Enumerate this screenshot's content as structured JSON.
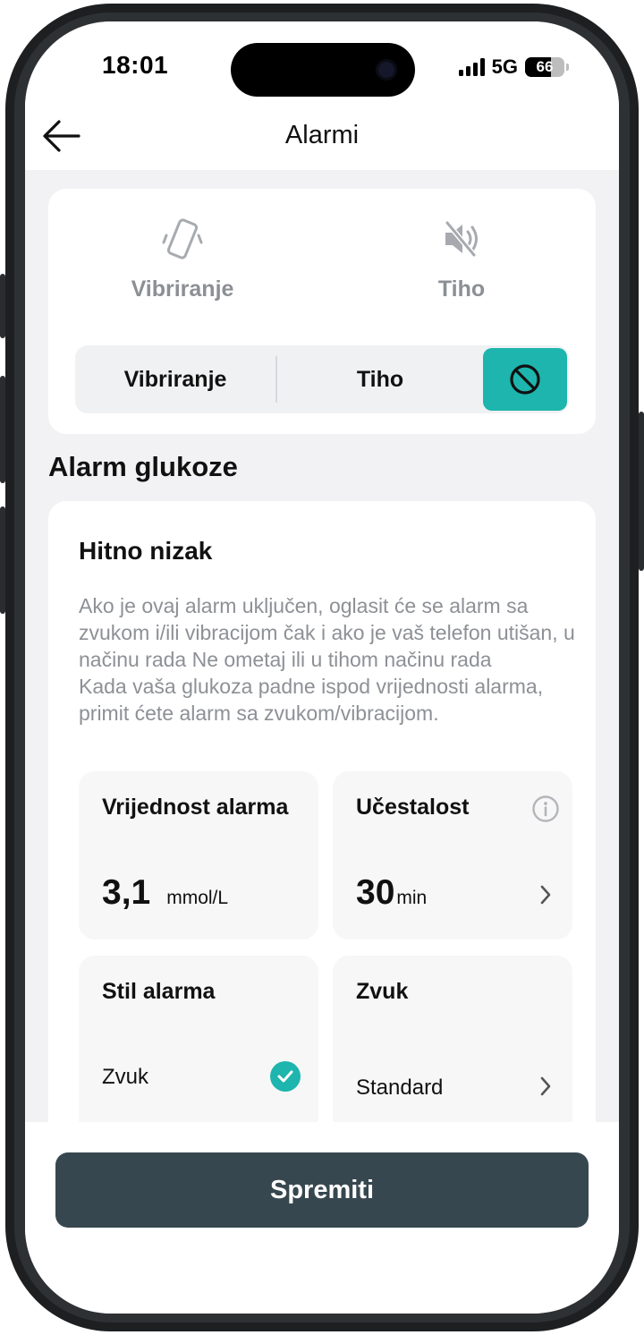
{
  "status_bar": {
    "time": "18:01",
    "network": "5G",
    "battery_level": "66"
  },
  "header": {
    "title": "Alarmi",
    "back_icon": "arrow-left-icon"
  },
  "sound_mode": {
    "options": [
      {
        "label": "Vibriranje",
        "icon": "vibrate-phone-icon"
      },
      {
        "label": "Tiho",
        "icon": "speaker-muted-icon"
      }
    ],
    "segments": [
      {
        "label": "Vibriranje"
      },
      {
        "label": "Tiho"
      },
      {
        "icon": "do-not-disturb-icon",
        "selected": true
      }
    ]
  },
  "glucose": {
    "section_title": "Alarm glukoze",
    "alarm_title": "Hitno nizak",
    "description_1": "Ako je ovaj alarm uključen, oglasit će se alarm sa zvukom i/ili vibracijom čak i ako je vaš telefon utišan, u načinu rada Ne ometaj ili u tihom načinu rada",
    "description_2": "Kada vaša glukoza padne ispod vrijednosti alarma, primit ćete alarm sa zvukom/vibracijom.",
    "tiles": {
      "value": {
        "title": "Vrijednost alarma",
        "number": "3,1",
        "unit": "mmol/L"
      },
      "frequency": {
        "title": "Učestalost",
        "number": "30",
        "unit": "min"
      },
      "style": {
        "title": "Stil alarma",
        "option": "Zvuk"
      },
      "sound": {
        "title": "Zvuk",
        "value": "Standard"
      }
    }
  },
  "footer": {
    "save_label": "Spremiti"
  },
  "colors": {
    "accent": "#1db5ad",
    "primary_button": "#37474f",
    "muted_text": "#8d9095",
    "background": "#f2f2f4"
  }
}
